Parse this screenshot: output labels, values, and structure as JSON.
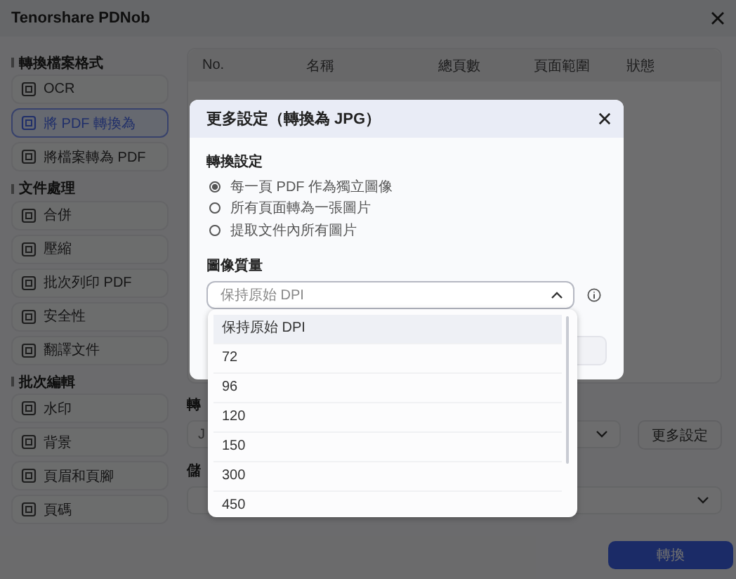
{
  "window": {
    "title": "Tenorshare PDNob"
  },
  "sidebar": {
    "sections": [
      {
        "title": "轉換檔案格式",
        "items": [
          {
            "label": "OCR",
            "selected": false
          },
          {
            "label": "將 PDF 轉換為",
            "selected": true
          },
          {
            "label": "將檔案轉為 PDF",
            "selected": false
          }
        ]
      },
      {
        "title": "文件處理",
        "items": [
          {
            "label": "合併",
            "selected": false
          },
          {
            "label": "壓縮",
            "selected": false
          },
          {
            "label": "批次列印 PDF",
            "selected": false
          },
          {
            "label": "安全性",
            "selected": false
          },
          {
            "label": "翻譯文件",
            "selected": false
          }
        ]
      },
      {
        "title": "批次編輯",
        "items": [
          {
            "label": "水印",
            "selected": false
          },
          {
            "label": "背景",
            "selected": false
          },
          {
            "label": "頁眉和頁腳",
            "selected": false
          },
          {
            "label": "頁碼",
            "selected": false
          }
        ]
      }
    ]
  },
  "table": {
    "columns": [
      "No.",
      "名稱",
      "總頁數",
      "頁面範圍",
      "狀態"
    ]
  },
  "convert_to": {
    "label": "轉",
    "value": "J",
    "more_button": "更多設定"
  },
  "save_to": {
    "label": "儲"
  },
  "convert_button": "轉換",
  "dialog": {
    "title": "更多設定（轉換為 JPG）",
    "conversion": {
      "heading": "轉換設定",
      "options": [
        {
          "label": "每一頁 PDF 作為獨立圖像",
          "selected": true
        },
        {
          "label": "所有頁面轉為一張圖片",
          "selected": false
        },
        {
          "label": "提取文件內所有圖片",
          "selected": false
        }
      ]
    },
    "quality": {
      "heading": "圖像質量",
      "value": "保持原始 DPI",
      "expanded": true,
      "options": [
        {
          "label": "保持原始 DPI",
          "selected": true
        },
        {
          "label": "72",
          "selected": false
        },
        {
          "label": "96",
          "selected": false
        },
        {
          "label": "120",
          "selected": false
        },
        {
          "label": "150",
          "selected": false
        },
        {
          "label": "300",
          "selected": false
        },
        {
          "label": "450",
          "selected": false
        }
      ]
    }
  }
}
